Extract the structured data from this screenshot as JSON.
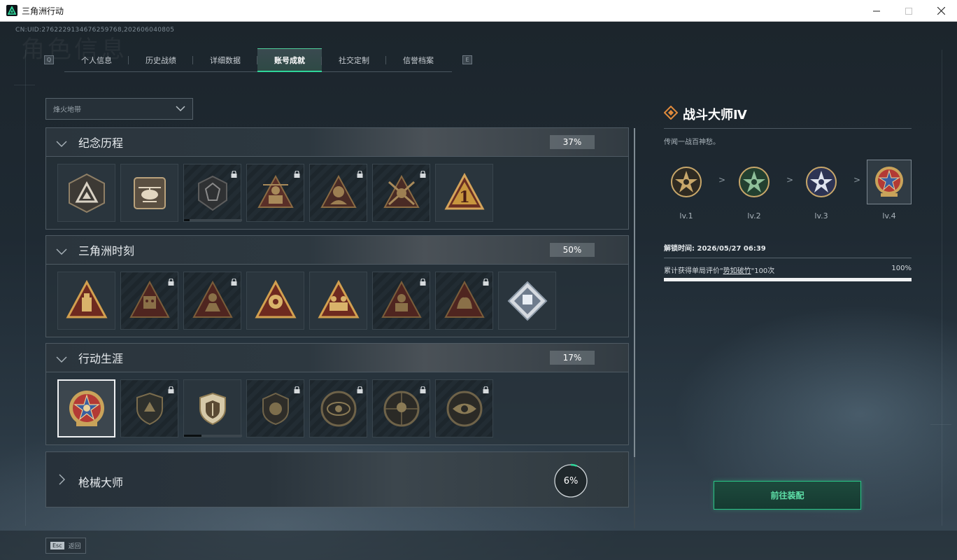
{
  "window": {
    "title": "三角洲行动"
  },
  "uid": "CN:UID:2762229134676259768,202606040805",
  "ghost_title": "角色信息",
  "tabs": [
    {
      "label": "个人信息"
    },
    {
      "label": "历史战绩"
    },
    {
      "label": "详细数据"
    },
    {
      "label": "账号成就",
      "active": true
    },
    {
      "label": "社交定制"
    },
    {
      "label": "信誉档案"
    }
  ],
  "tab_hints": {
    "left": "Q",
    "right": "E"
  },
  "mode_dropdown": {
    "selected": "烽火地带"
  },
  "categories": [
    {
      "title": "纪念历程",
      "percent": "37%",
      "badges": [
        {
          "icon": "triangle-logo-badge",
          "locked": false
        },
        {
          "icon": "helicopter-badge",
          "locked": false
        },
        {
          "icon": "crest-badge",
          "locked": true,
          "progress": 0.1
        },
        {
          "icon": "soldier-badge",
          "locked": true
        },
        {
          "icon": "commander-badge",
          "locked": true
        },
        {
          "icon": "crossed-rifles-badge",
          "locked": true
        },
        {
          "icon": "number-one-badge",
          "locked": false
        }
      ]
    },
    {
      "title": "三角洲时刻",
      "percent": "50%",
      "badges": [
        {
          "icon": "flashdrive-badge",
          "locked": false
        },
        {
          "icon": "robot-badge",
          "locked": true
        },
        {
          "icon": "operator-badge",
          "locked": true
        },
        {
          "icon": "hands-badge",
          "locked": false
        },
        {
          "icon": "team-badge",
          "locked": false
        },
        {
          "icon": "fighter-badge",
          "locked": true
        },
        {
          "icon": "beast-badge",
          "locked": true
        },
        {
          "icon": "crystal-cube-badge",
          "locked": false
        }
      ]
    },
    {
      "title": "行动生涯",
      "percent": "17%",
      "badges": [
        {
          "icon": "star-medal-badge",
          "locked": false,
          "selected": true
        },
        {
          "icon": "shield-claw-badge",
          "locked": true
        },
        {
          "icon": "shield-badge",
          "locked": false,
          "progress": 0.3
        },
        {
          "icon": "helmet-badge",
          "locked": true
        },
        {
          "icon": "orbit-badge",
          "locked": true
        },
        {
          "icon": "skull-target-badge",
          "locked": true
        },
        {
          "icon": "eye-badge",
          "locked": true
        }
      ]
    }
  ],
  "gun_category": {
    "title": "枪械大师",
    "percent": "6%",
    "progress": 0.06
  },
  "detail": {
    "title": "战斗大师Ⅳ",
    "description": "传闻一战百神愁。",
    "levels": [
      {
        "label": "lv.1",
        "color": "#c8a76a"
      },
      {
        "label": "lv.2",
        "color": "#5f9a6c"
      },
      {
        "label": "lv.3",
        "color": "#9aa8c8"
      },
      {
        "label": "lv.4",
        "color": "#c23f3a",
        "current": true
      }
    ],
    "unlock_time": "解锁时间: 2026/05/27 06:39",
    "criteria_prefix": "累计获得单局评价\"",
    "criteria_highlight": "势如破竹",
    "criteria_suffix": "\"100次",
    "criteria_percent": "100%",
    "criteria_progress": 1.0,
    "equip_button": "前往装配"
  },
  "footer": {
    "esc_key": "Esc",
    "esc_label": "返回"
  },
  "colors": {
    "accent": "#2fd69a",
    "gold": "#c9a35a"
  }
}
